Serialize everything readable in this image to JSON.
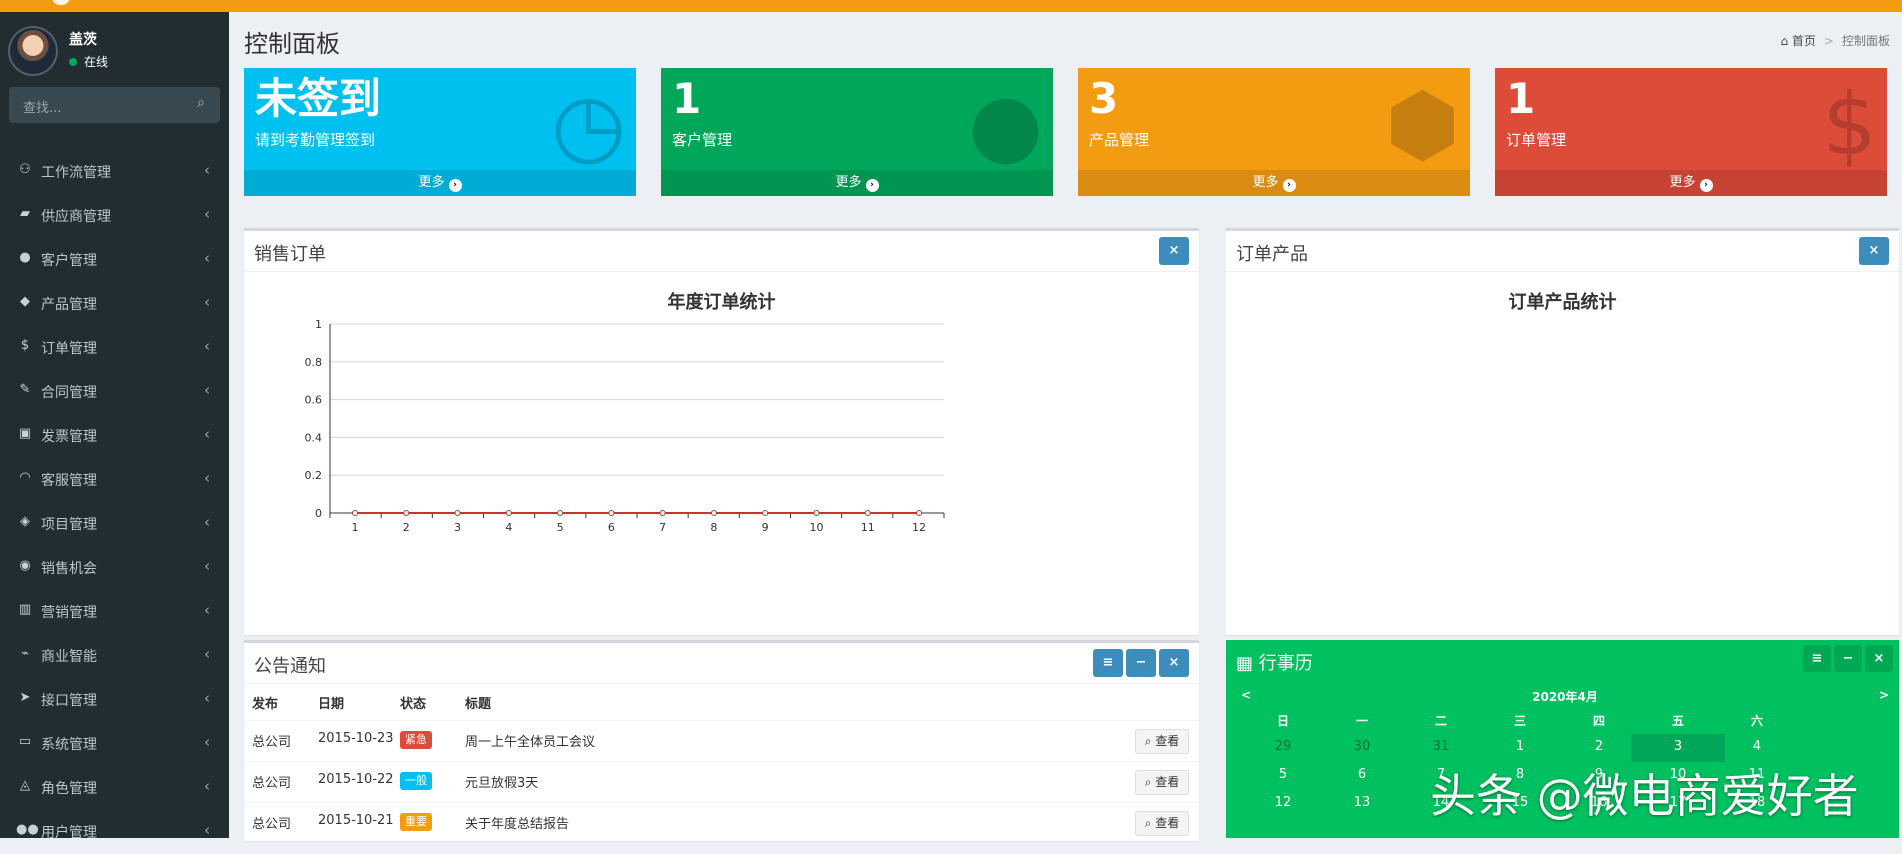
{
  "colors": {
    "top_bar": "#f39c12",
    "sidebar": "#222d32",
    "aqua": "#00c0ef",
    "green": "#00a65a",
    "orange": "#f39c12",
    "red": "#dd4b39",
    "calendar": "#00c060",
    "primary": "#3c8dbc"
  },
  "user": {
    "name": "盖茨",
    "status": "在线"
  },
  "sidebar": {
    "search_placeholder": "查找...",
    "items": [
      {
        "label": "工作流管理",
        "icon": "sitemap-icon",
        "glyph": "⚇",
        "name": "sidebar-item-workflow"
      },
      {
        "label": "供应商管理",
        "icon": "truck-icon",
        "glyph": "▰",
        "name": "sidebar-item-suppliers"
      },
      {
        "label": "客户管理",
        "icon": "user-icon",
        "glyph": "●",
        "name": "sidebar-item-customers"
      },
      {
        "label": "产品管理",
        "icon": "cube-icon",
        "glyph": "◆",
        "name": "sidebar-item-products"
      },
      {
        "label": "订单管理",
        "icon": "dollar-icon",
        "glyph": "$",
        "name": "sidebar-item-orders"
      },
      {
        "label": "合同管理",
        "icon": "pencil-icon",
        "glyph": "✎",
        "name": "sidebar-item-contracts"
      },
      {
        "label": "发票管理",
        "icon": "money-icon",
        "glyph": "▣",
        "name": "sidebar-item-invoices"
      },
      {
        "label": "客服管理",
        "icon": "headset-icon",
        "glyph": "◠",
        "name": "sidebar-item-service"
      },
      {
        "label": "项目管理",
        "icon": "cubes-icon",
        "glyph": "◈",
        "name": "sidebar-item-projects"
      },
      {
        "label": "销售机会",
        "icon": "binoculars-icon",
        "glyph": "◉",
        "name": "sidebar-item-opportunities"
      },
      {
        "label": "营销管理",
        "icon": "bar-chart-icon",
        "glyph": "▥",
        "name": "sidebar-item-marketing"
      },
      {
        "label": "商业智能",
        "icon": "line-chart-icon",
        "glyph": "⌁",
        "name": "sidebar-item-bi"
      },
      {
        "label": "接口管理",
        "icon": "paper-plane-icon",
        "glyph": "➤",
        "name": "sidebar-item-api"
      },
      {
        "label": "系统管理",
        "icon": "desktop-icon",
        "glyph": "▭",
        "name": "sidebar-item-system"
      },
      {
        "label": "角色管理",
        "icon": "graduation-cap-icon",
        "glyph": "◬",
        "name": "sidebar-item-roles"
      },
      {
        "label": "用户管理",
        "icon": "users-icon",
        "glyph": "●●",
        "name": "sidebar-item-users"
      }
    ]
  },
  "header": {
    "title": "控制面板",
    "breadcrumb_home": "首页",
    "breadcrumb_current": "控制面板",
    "breadcrumb_sep": ">"
  },
  "stats": [
    {
      "value": "未签到",
      "label": "请到考勤管理签到",
      "footer": "更多",
      "icon": "clock-icon",
      "glyph": "◷",
      "color": "#00c0ef"
    },
    {
      "value": "1",
      "label": "客户管理",
      "footer": "更多",
      "icon": "user-icon",
      "glyph": "●",
      "color": "#00a65a"
    },
    {
      "value": "3",
      "label": "产品管理",
      "footer": "更多",
      "icon": "cube-icon",
      "glyph": "⬢",
      "color": "#f39c12"
    },
    {
      "value": "1",
      "label": "订单管理",
      "footer": "更多",
      "icon": "dollar-icon",
      "glyph": "$",
      "color": "#dd4b39"
    }
  ],
  "sales_box": {
    "title": "销售订单",
    "close_label": "×"
  },
  "product_box": {
    "title": "订单产品",
    "close_label": "×",
    "chart_title": "订单产品统计"
  },
  "chart_data": {
    "type": "line",
    "title": "年度订单统计",
    "xlabel": "",
    "ylabel": "",
    "x": [
      1,
      2,
      3,
      4,
      5,
      6,
      7,
      8,
      9,
      10,
      11,
      12
    ],
    "ylim": [
      0,
      1
    ],
    "yticks": [
      0,
      0.2,
      0.4,
      0.6,
      0.8,
      1
    ],
    "grid": true,
    "series": [
      {
        "values": [
          0,
          0,
          0,
          0,
          0,
          0,
          0,
          0,
          0,
          0,
          0,
          0
        ],
        "color": "#c23531"
      }
    ]
  },
  "notice": {
    "title": "公告通知",
    "tools": [
      "≡",
      "−",
      "×"
    ],
    "columns": [
      "发布",
      "日期",
      "状态",
      "标题"
    ],
    "view_label": "查看",
    "rows": [
      {
        "publisher": "总公司",
        "date": "2015-10-23",
        "status": "紧急",
        "status_color": "#dd4b39",
        "title": "周一上午全体员工会议"
      },
      {
        "publisher": "总公司",
        "date": "2015-10-22",
        "status": "一般",
        "status_color": "#00c0ef",
        "title": "元旦放假3天"
      },
      {
        "publisher": "总公司",
        "date": "2015-10-21",
        "status": "重要",
        "status_color": "#f39c12",
        "title": "关于年度总结报告"
      }
    ]
  },
  "calendar": {
    "title": "行事历",
    "tools": [
      "≡",
      "−",
      "×"
    ],
    "month": "2020年4月",
    "prev": "<",
    "next": ">",
    "weekdays": [
      "日",
      "一",
      "二",
      "三",
      "四",
      "五",
      "六"
    ],
    "weeks": [
      [
        "29",
        "30",
        "31",
        "1",
        "2",
        "3",
        "4"
      ],
      [
        "5",
        "6",
        "7",
        "8",
        "9",
        "10",
        "11"
      ],
      [
        "12",
        "13",
        "14",
        "15",
        "16",
        "17",
        "18"
      ]
    ],
    "today": "3"
  },
  "watermark": "头条 @微电商爱好者"
}
